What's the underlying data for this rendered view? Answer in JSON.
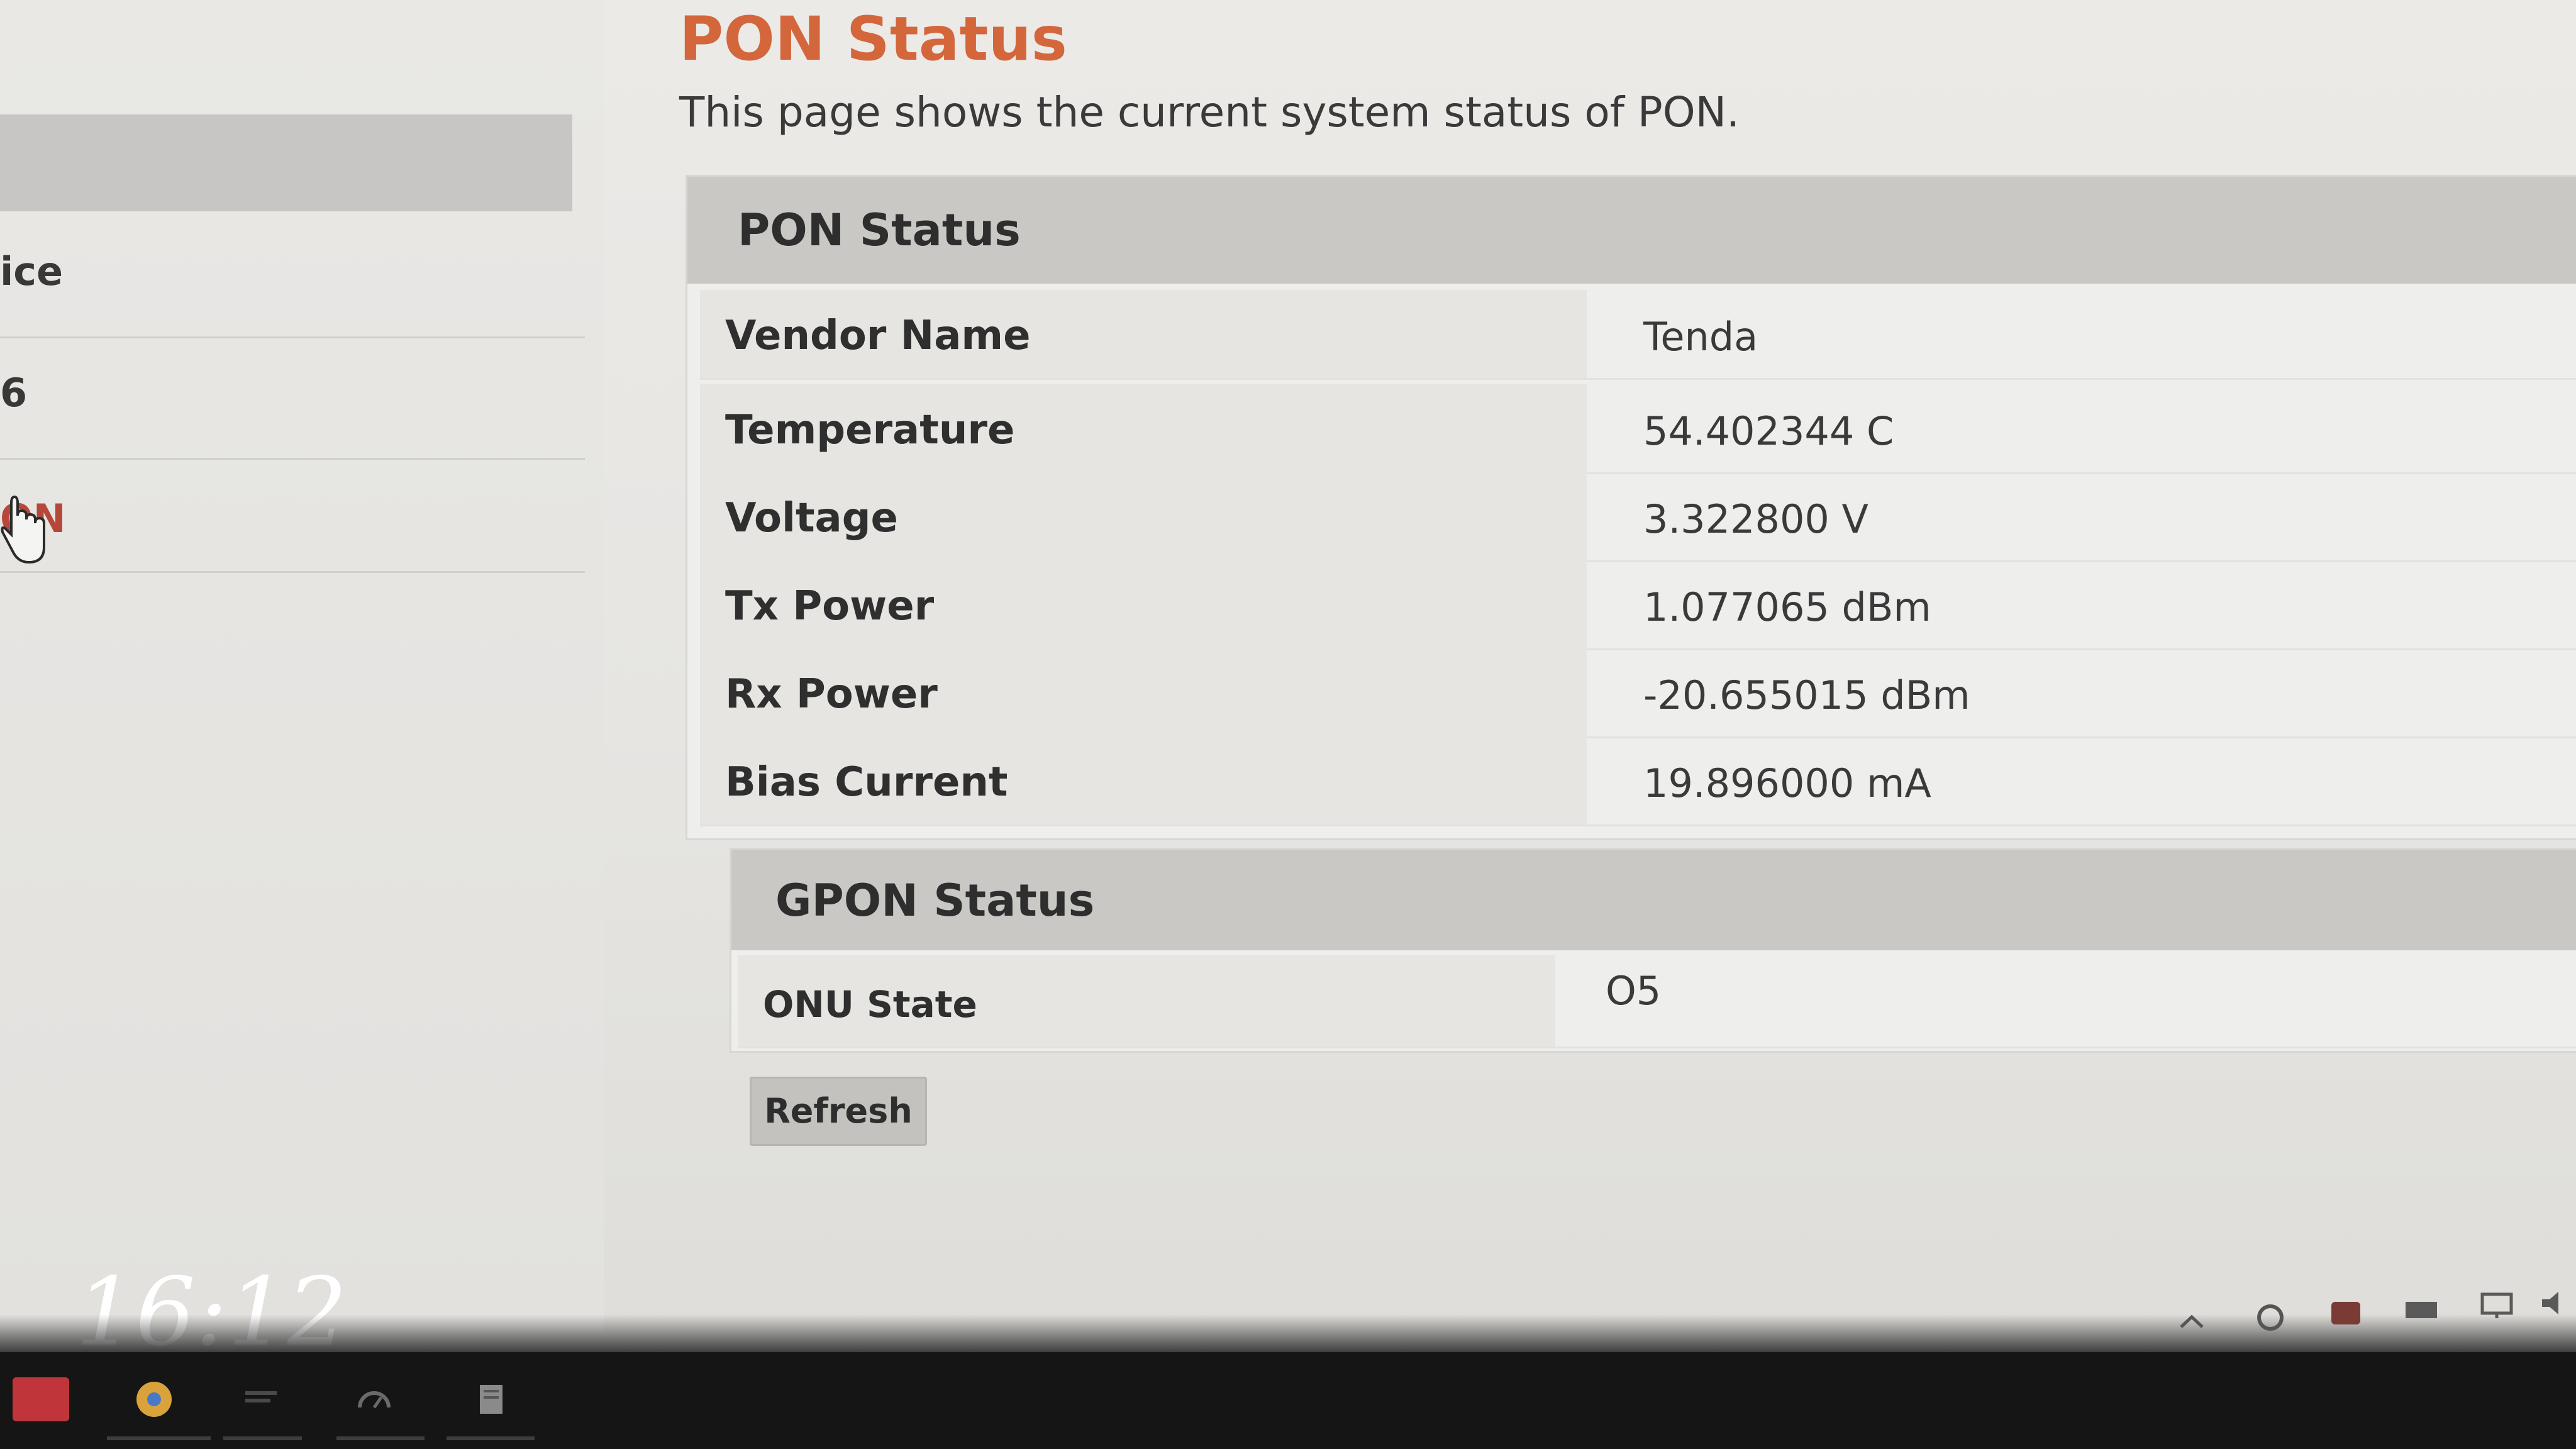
{
  "page": {
    "title": "PON Status",
    "description": "This page shows the current system status of PON."
  },
  "sidebar": {
    "items": [
      {
        "label": "ice"
      },
      {
        "label": "6"
      },
      {
        "label": "ON"
      }
    ]
  },
  "pon_status": {
    "header": "PON Status",
    "rows": [
      {
        "label": "Vendor Name",
        "value": "Tenda"
      },
      {
        "label": "Temperature",
        "value": "54.402344 C"
      },
      {
        "label": "Voltage",
        "value": "3.322800 V"
      },
      {
        "label": "Tx Power",
        "value": "1.077065 dBm"
      },
      {
        "label": "Rx Power",
        "value": "-20.655015 dBm"
      },
      {
        "label": "Bias Current",
        "value": "19.896000 mA"
      }
    ]
  },
  "gpon_status": {
    "header": "GPON Status",
    "rows": [
      {
        "label": "ONU State",
        "value": "O5"
      }
    ]
  },
  "actions": {
    "refresh_label": "Refresh"
  },
  "overlay": {
    "clock": "16:12"
  },
  "taskbar": {
    "apps": [
      {
        "icon": "app-red-icon",
        "color": "#c0353a"
      },
      {
        "icon": "chrome-icon",
        "color": "#d9a23a"
      },
      {
        "icon": "window-icon",
        "color": "#4a4a4a"
      },
      {
        "icon": "gauge-icon",
        "color": "#6a6a6a"
      },
      {
        "icon": "document-icon",
        "color": "#8a8a8a"
      }
    ],
    "tray": [
      "chevron-up-icon",
      "settings-icon",
      "app-tray-icon",
      "keyboard-icon",
      "monitor-icon",
      "speaker-icon"
    ]
  },
  "colors": {
    "accent": "#d4663c",
    "header_bg": "#c9c8c5",
    "taskbar_bg": "#151515"
  }
}
